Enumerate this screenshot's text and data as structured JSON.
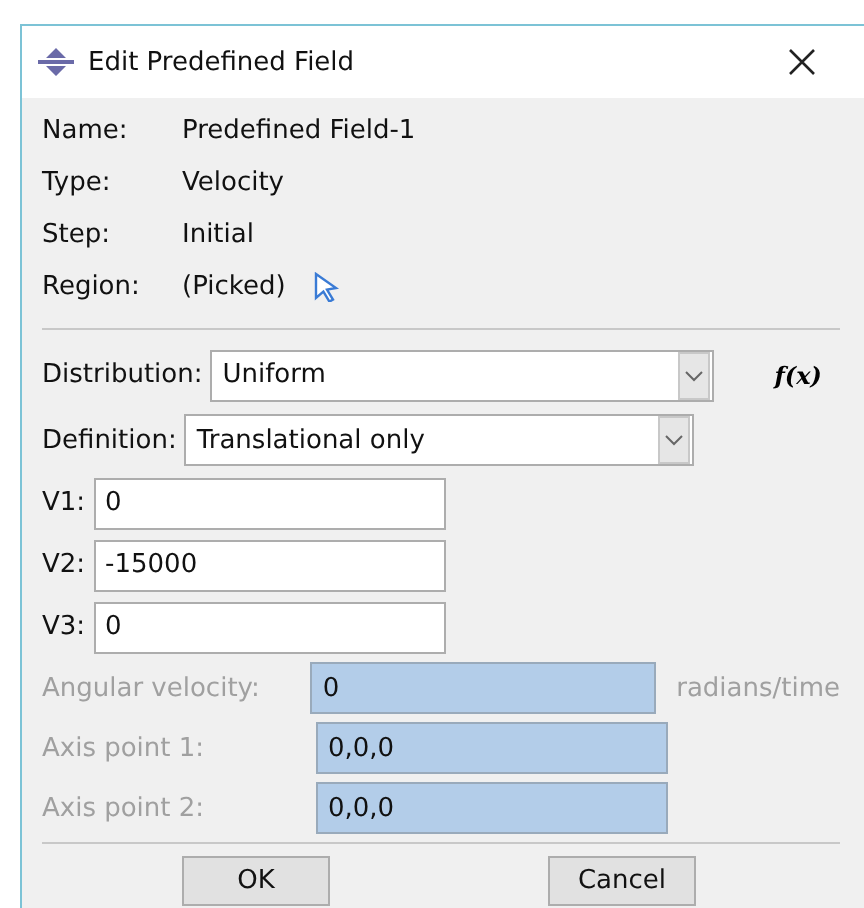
{
  "window": {
    "title": "Edit Predefined Field"
  },
  "info": [
    {
      "label": "Name:",
      "value": "Predefined Field-1"
    },
    {
      "label": "Type:",
      "value": "Velocity"
    },
    {
      "label": "Step:",
      "value": "Initial"
    },
    {
      "label": "Region:",
      "value": "(Picked)"
    }
  ],
  "distribution": {
    "label": "Distribution:",
    "value": "Uniform",
    "function_button": "f(x)"
  },
  "definition": {
    "label": "Definition:",
    "value": "Translational only"
  },
  "velocity_fields": [
    {
      "label": "V1:",
      "value": "0"
    },
    {
      "label": "V2:",
      "value": "-15000"
    },
    {
      "label": "V3:",
      "value": "0"
    }
  ],
  "rotation_fields": [
    {
      "label": "Angular velocity:",
      "value": "0",
      "unit": "radians/time",
      "disabled": true
    },
    {
      "label": "Axis point 1:",
      "value": "0,0,0",
      "disabled": true
    },
    {
      "label": "Axis point 2:",
      "value": "0,0,0",
      "disabled": true
    }
  ],
  "buttons": [
    "OK",
    "Cancel"
  ]
}
